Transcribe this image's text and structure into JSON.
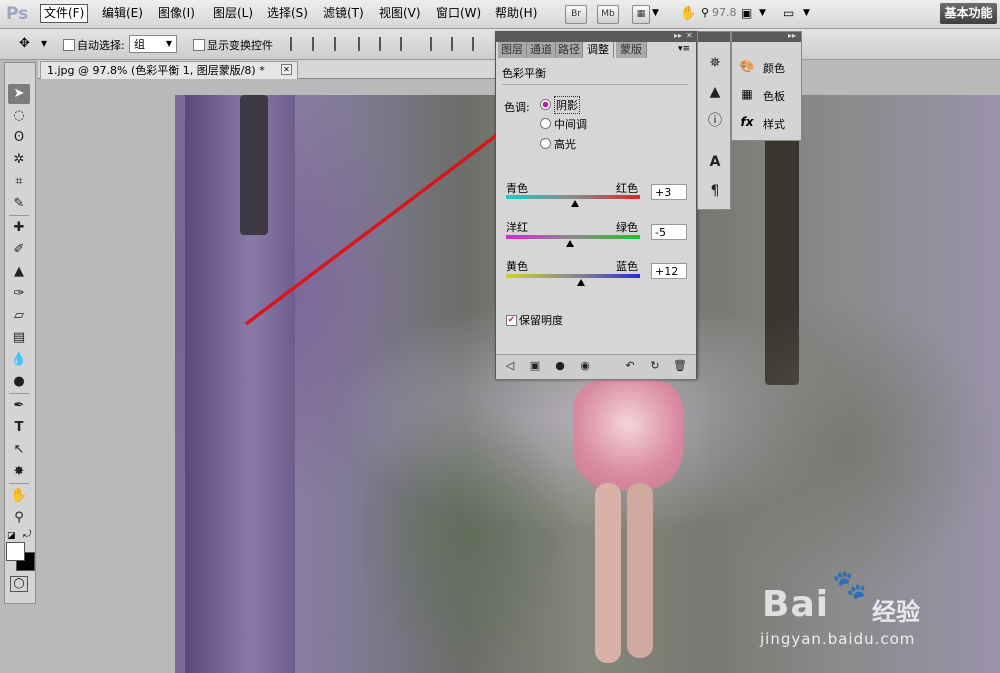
{
  "app": {
    "logo": "Ps"
  },
  "menubar": {
    "items": [
      "文件(F)",
      "编辑(E)",
      "图像(I)",
      "图层(L)",
      "选择(S)",
      "滤镜(T)",
      "视图(V)",
      "窗口(W)",
      "帮助(H)"
    ],
    "buttons": [
      "Br",
      "Mb"
    ],
    "zoom": "97.8",
    "workspace": "基本功能"
  },
  "options": {
    "auto_select_label": "自动选择:",
    "auto_select_value": "组",
    "show_transform_label": "显示变换控件"
  },
  "document": {
    "tab_title": "1.jpg @ 97.8% (色彩平衡 1, 图层蒙版/8) *"
  },
  "panel": {
    "tabs": [
      "图层",
      "通道",
      "路径",
      "调整",
      "蒙版"
    ],
    "active_tab": "调整",
    "title": "色彩平衡",
    "tone_label": "色调:",
    "tones": [
      "阴影",
      "中间调",
      "高光"
    ],
    "selected_tone": "阴影",
    "sliders": [
      {
        "left": "青色",
        "right": "红色",
        "value": "+3",
        "amount": 3
      },
      {
        "left": "洋红",
        "right": "绿色",
        "value": "-5",
        "amount": -5
      },
      {
        "left": "黄色",
        "right": "蓝色",
        "value": "+12",
        "amount": 12
      }
    ],
    "preserve_label": "保留明度",
    "preserve_checked": true
  },
  "colorpanel": {
    "items": [
      "颜色",
      "色板",
      "样式"
    ]
  },
  "watermark": {
    "logo": "Bai",
    "logo2": "经验",
    "url": "jingyan.baidu.com"
  },
  "colors": {
    "accent_red": "#d9161c",
    "panel_bg": "#d6d6d6"
  }
}
